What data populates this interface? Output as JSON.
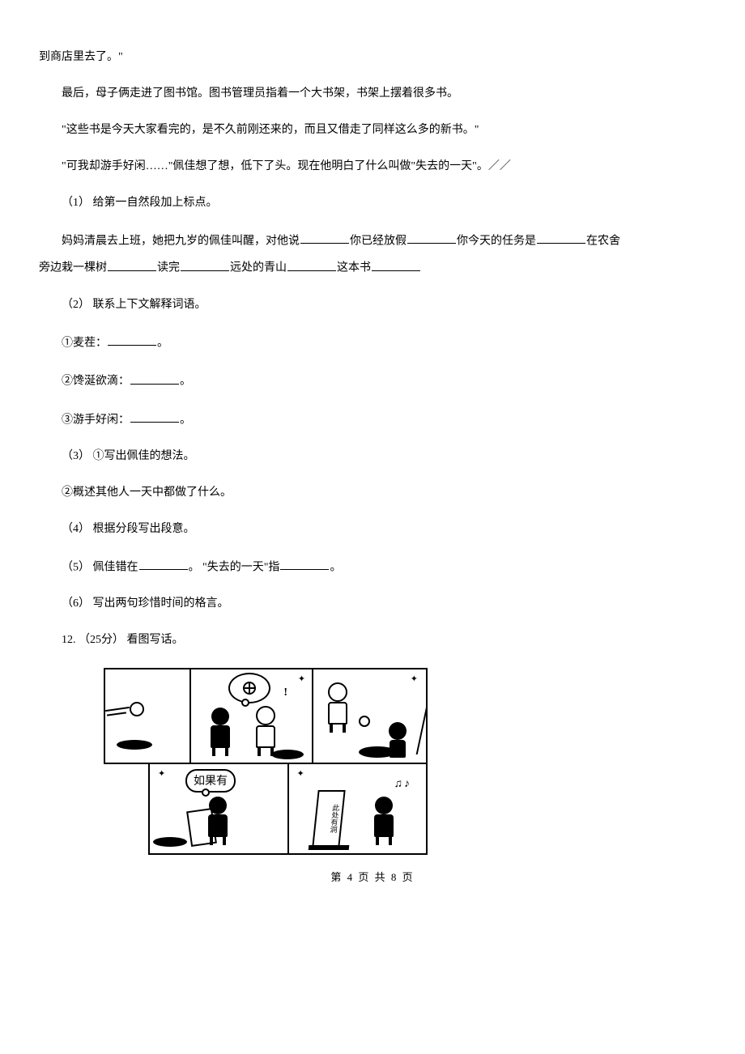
{
  "para": {
    "p1": "到商店里去了。\"",
    "p2": "最后，母子俩走进了图书馆。图书管理员指着一个大书架，书架上摆着很多书。",
    "p3": "\"这些书是今天大家看完的，是不久前刚还来的，而且又借走了同样这么多的新书。\"",
    "p4": "\"可我却游手好闲……\"佩佳想了想，低下了头。现在他明白了什么叫做\"失去的一天\"。／／",
    "q1": "（1） 给第一自然段加上标点。",
    "fill_lead": "妈妈清晨去上班，她把九岁的佩佳叫醒，对他说",
    "fill_seg1": "你已经放假",
    "fill_seg2": "你今天的任务是",
    "fill_seg3": "在农舍",
    "fill_line2a": "旁边栽一棵树",
    "fill_line2b": "读完",
    "fill_line2c": "远处的青山",
    "fill_line2d": "这本书",
    "q2": "（2） 联系上下文解释词语。",
    "q2a_pre": "①麦茬：",
    "q2a_post": "。",
    "q2b_pre": "②馋涎欲滴：",
    "q2b_post": "。",
    "q2c_pre": "③游手好闲：",
    "q2c_post": "。",
    "q3": "（3） ①写出佩佳的想法。",
    "q3b": "②概述其他人一天中都做了什么。",
    "q4": "（4） 根据分段写出段意。",
    "q5_pre": "（5） 佩佳错在",
    "q5_mid": "。 \"失去的一天\"指",
    "q5_post": "。",
    "q6": "（6） 写出两句珍惜时间的格言。",
    "q12": "12. （25分） 看图写话。"
  },
  "comic": {
    "bubble4_text": "如果有",
    "sign_text": "此处有洞",
    "notes": "♫♪"
  },
  "footer": "第 4 页 共 8 页"
}
